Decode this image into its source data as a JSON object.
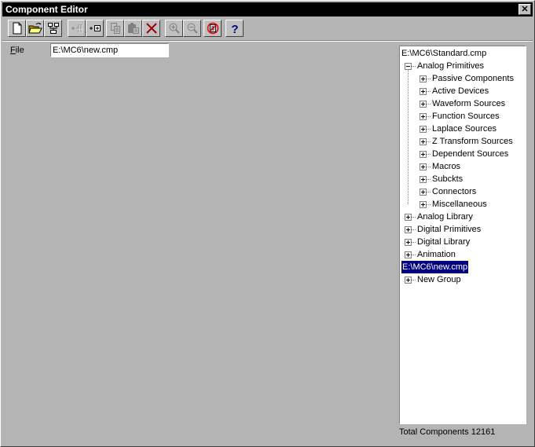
{
  "window": {
    "title": "Component Editor",
    "close_label": "✕"
  },
  "toolbar": {
    "buttons": [
      {
        "name": "new-file",
        "icon": "new-document-icon",
        "enabled": true
      },
      {
        "name": "open-file",
        "icon": "open-folder-icon",
        "enabled": true
      },
      {
        "name": "merge",
        "icon": "hierarchy-icon",
        "enabled": true
      },
      {
        "name": "add-part",
        "icon": "add-part-icon",
        "enabled": false
      },
      {
        "name": "add-group",
        "icon": "add-group-icon",
        "enabled": true
      },
      {
        "name": "copy",
        "icon": "copy-icon",
        "enabled": false
      },
      {
        "name": "paste",
        "icon": "paste-icon",
        "enabled": false
      },
      {
        "name": "delete",
        "icon": "delete-icon",
        "enabled": true
      },
      {
        "name": "zoom-in",
        "icon": "zoom-in-icon",
        "enabled": false
      },
      {
        "name": "zoom-out",
        "icon": "zoom-out-icon",
        "enabled": false
      },
      {
        "name": "no-list",
        "icon": "no-list-icon",
        "enabled": true
      },
      {
        "name": "help",
        "icon": "help-icon",
        "enabled": true
      }
    ]
  },
  "file": {
    "label_accel": "F",
    "label_rest": "ile",
    "value": "E:\\MC6\\new.cmp"
  },
  "tree": {
    "roots": [
      {
        "label": "E:\\MC6\\Standard.cmp",
        "selected": false,
        "children": [
          {
            "label": "Analog Primitives",
            "expanded": true,
            "children": [
              "Passive Components",
              "Active Devices",
              "Waveform Sources",
              "Function Sources",
              "Laplace Sources",
              "Z Transform Sources",
              "Dependent Sources",
              "Macros",
              "Subckts",
              "Connectors",
              "Miscellaneous"
            ]
          },
          {
            "label": "Analog Library",
            "expanded": false
          },
          {
            "label": "Digital Primitives",
            "expanded": false
          },
          {
            "label": "Digital Library",
            "expanded": false
          },
          {
            "label": "Animation",
            "expanded": false
          }
        ]
      },
      {
        "label": "E:\\MC6\\new.cmp",
        "selected": true,
        "children": [
          {
            "label": "New Group",
            "expanded": false
          }
        ]
      }
    ]
  },
  "status": {
    "total_label": "Total Components",
    "total_value": "12161",
    "total_text": "Total Components 12161"
  }
}
